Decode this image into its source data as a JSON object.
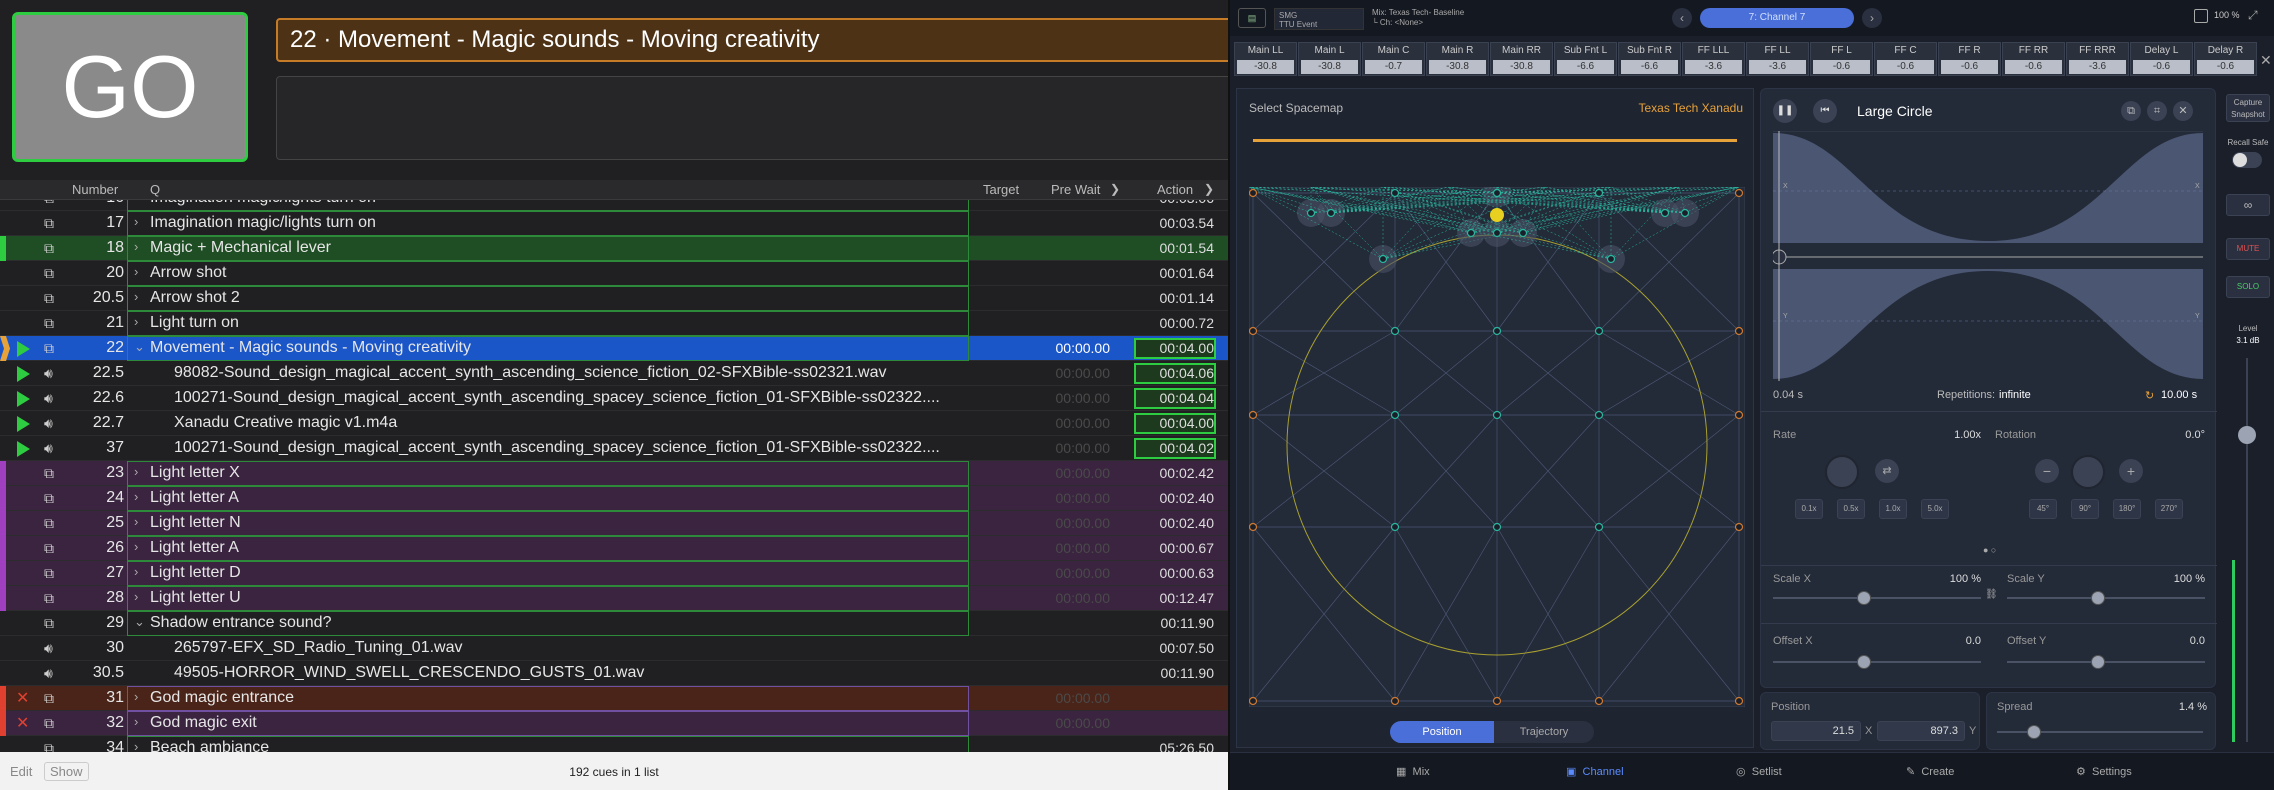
{
  "go_label": "GO",
  "current_cue_title": "22 · Movement - Magic sounds - Moving creativity",
  "list_header": {
    "number": "Number",
    "q": "Q",
    "target": "Target",
    "prewait": "Pre Wait",
    "action": "Action"
  },
  "cues": [
    {
      "num": "16",
      "name": "Imagination magic/lights turn on",
      "action": "00:03.06",
      "color": "",
      "group": true,
      "partial": true
    },
    {
      "num": "17",
      "name": "Imagination magic/lights turn on",
      "action": "00:03.54",
      "color": "",
      "group": true
    },
    {
      "num": "18",
      "name": "Magic + Mechanical lever",
      "action": "00:01.54",
      "color": "#1f4d24",
      "bar": "#2ecc40",
      "group": true
    },
    {
      "num": "20",
      "name": "Arrow shot",
      "action": "00:01.64",
      "color": "",
      "group": true
    },
    {
      "num": "20.5",
      "name": "Arrow shot 2",
      "action": "00:01.14",
      "color": "",
      "group": true
    },
    {
      "num": "21",
      "name": "Light turn on",
      "action": "00:00.72",
      "color": "",
      "group": true
    },
    {
      "num": "22",
      "name": "Movement - Magic sounds - Moving creativity",
      "prewait": "00:00.00",
      "action": "00:04.00",
      "color": "#1b56c9",
      "group": true,
      "selected": true,
      "playing": true,
      "expanded": true
    },
    {
      "num": "22.5",
      "name": "98082-Sound_design_magical_accent_synth_ascending_science_fiction_02-SFXBible-ss02321.wav",
      "prewait": "00:00.00",
      "action": "00:04.06",
      "child": true,
      "playing": true,
      "audio": true
    },
    {
      "num": "22.6",
      "name": "100271-Sound_design_magical_accent_synth_ascending_spacey_science_fiction_01-SFXBible-ss02322....",
      "prewait": "00:00.00",
      "action": "00:04.04",
      "child": true,
      "playing": true,
      "audio": true
    },
    {
      "num": "22.7",
      "name": "Xanadu Creative magic v1.m4a",
      "prewait": "00:00.00",
      "action": "00:04.00",
      "child": true,
      "playing": true,
      "audio": true
    },
    {
      "num": "37",
      "name": "100271-Sound_design_magical_accent_synth_ascending_spacey_science_fiction_01-SFXBible-ss02322....",
      "prewait": "00:00.00",
      "action": "00:04.02",
      "child": true,
      "playing": true,
      "audio": true
    },
    {
      "num": "23",
      "name": "Light letter X",
      "prewait": "00:00.00",
      "action": "00:02.42",
      "color": "#3a2440",
      "bar": "#a040c0",
      "group": true
    },
    {
      "num": "24",
      "name": "Light letter A",
      "prewait": "00:00.00",
      "action": "00:02.40",
      "color": "#3a2440",
      "bar": "#a040c0",
      "group": true
    },
    {
      "num": "25",
      "name": "Light letter N",
      "prewait": "00:00.00",
      "action": "00:02.40",
      "color": "#3a2440",
      "bar": "#a040c0",
      "group": true
    },
    {
      "num": "26",
      "name": "Light letter A",
      "prewait": "00:00.00",
      "action": "00:00.67",
      "color": "#3a2440",
      "bar": "#a040c0",
      "group": true
    },
    {
      "num": "27",
      "name": "Light letter D",
      "prewait": "00:00.00",
      "action": "00:00.63",
      "color": "#3a2440",
      "bar": "#a040c0",
      "group": true
    },
    {
      "num": "28",
      "name": "Light letter U",
      "prewait": "00:00.00",
      "action": "00:12.47",
      "color": "#3a2440",
      "bar": "#a040c0",
      "group": true
    },
    {
      "num": "29",
      "name": "Shadow entrance sound?",
      "action": "00:11.90",
      "color": "",
      "group": true,
      "expanded": true
    },
    {
      "num": "30",
      "name": "265797-EFX_SD_Radio_Tuning_01.wav",
      "action": "00:07.50",
      "child": true,
      "audio": true
    },
    {
      "num": "30.5",
      "name": "49505-HORROR_WIND_SWELL_CRESCENDO_GUSTS_01.wav",
      "action": "00:11.90",
      "child": true,
      "audio": true
    },
    {
      "num": "31",
      "name": "God magic entrance",
      "prewait": "00:00.00",
      "action": "",
      "color": "#4a2418",
      "bar": "#e04030",
      "group": true,
      "broken": true
    },
    {
      "num": "32",
      "name": "God magic exit",
      "prewait": "00:00.00",
      "action": "",
      "color": "#3a2440",
      "bar": "#e04030",
      "group": true,
      "broken": true
    },
    {
      "num": "34",
      "name": "Beach ambiance",
      "action": "05:26.50",
      "color": "",
      "group": true,
      "partial": true
    }
  ],
  "status": {
    "edit": "Edit",
    "show": "Show",
    "count": "192 cues in 1 list"
  },
  "spat": {
    "show_name": "SMG",
    "show_sub": "TTU Event",
    "mix": "Mix: Texas Tech- Baseline",
    "ch": "└ Ch: <None>",
    "channel": "7: Channel 7",
    "zoom": "100 %",
    "meters": [
      {
        "label": "Main LL",
        "value": "-30.8"
      },
      {
        "label": "Main L",
        "value": "-30.8"
      },
      {
        "label": "Main C",
        "value": "-0.7"
      },
      {
        "label": "Main R",
        "value": "-30.8"
      },
      {
        "label": "Main RR",
        "value": "-30.8"
      },
      {
        "label": "Sub Fnt L",
        "value": "-6.6"
      },
      {
        "label": "Sub Fnt R",
        "value": "-6.6"
      },
      {
        "label": "FF LLL",
        "value": "-3.6"
      },
      {
        "label": "FF LL",
        "value": "-3.6"
      },
      {
        "label": "FF L",
        "value": "-0.6"
      },
      {
        "label": "FF C",
        "value": "-0.6"
      },
      {
        "label": "FF R",
        "value": "-0.6"
      },
      {
        "label": "FF RR",
        "value": "-0.6"
      },
      {
        "label": "FF RRR",
        "value": "-3.6"
      },
      {
        "label": "Delay L",
        "value": "-0.6"
      },
      {
        "label": "Delay R",
        "value": "-0.6"
      }
    ],
    "spacemap_label": "Select Spacemap",
    "spacemap_selected": "Texas  Tech Xanadu",
    "seg_position": "Position",
    "seg_trajectory": "Trajectory",
    "motion_title": "Large Circle",
    "wave_start": "0.04 s",
    "repetitions_label": "Repetitions:",
    "repetitions_value": "infinite",
    "duration": "10.00 s",
    "rate_label": "Rate",
    "rate_value": "1.00x",
    "rotation_label": "Rotation",
    "rotation_value": "0.0°",
    "rate_presets": [
      "0.1x",
      "0.5x",
      "1.0x",
      "5.0x"
    ],
    "rot_presets": [
      "45°",
      "90°",
      "180°",
      "270°"
    ],
    "scalex_label": "Scale X",
    "scalex_value": "100 %",
    "scaley_label": "Scale Y",
    "scaley_value": "100 %",
    "offx_label": "Offset X",
    "offx_value": "0.0",
    "offy_label": "Offset Y",
    "offy_value": "0.0",
    "position_label": "Position",
    "pos_x": "21.5",
    "pos_x_axis": "X",
    "pos_y": "897.3",
    "pos_y_axis": "Y",
    "spread_label": "Spread",
    "spread_value": "1.4 %",
    "capture": "Capture Snapshot",
    "recall": "Recall Safe",
    "mute": "MUTE",
    "solo": "SOLO",
    "level_label": "Level",
    "level_value": "3.1 dB",
    "tabs": [
      "Mix",
      "Channel",
      "Setlist",
      "Create",
      "Settings"
    ],
    "x_axis": "X",
    "y_axis": "Y"
  },
  "colors": {
    "accent": "#4a6fd8",
    "go_border": "#2ecc40",
    "orange": "#e8a23a"
  }
}
